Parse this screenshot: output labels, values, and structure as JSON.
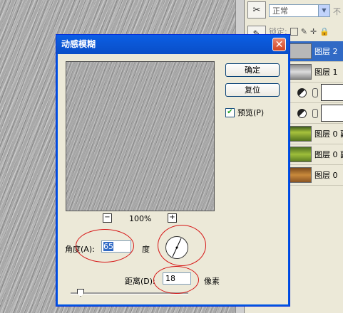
{
  "dialog": {
    "title": "动感模糊",
    "ok_label": "确定",
    "reset_label": "复位",
    "preview_label": "预览(P)",
    "preview_checked": true,
    "zoom_minus": "−",
    "zoom_plus": "+",
    "zoom_value": "100%",
    "angle_label": "角度(A):",
    "angle_value": "65",
    "angle_unit": "度",
    "distance_label": "距离(D):",
    "distance_value": "18",
    "distance_unit": "像素",
    "close_symbol": "✕"
  },
  "layers_panel": {
    "blend_mode": "正常",
    "opacity_cut": "不",
    "lock_label": "锁定:",
    "layers": [
      {
        "name": "图层 2",
        "selected": true,
        "kind": "image"
      },
      {
        "name": "图层 1",
        "selected": false,
        "kind": "image"
      },
      {
        "name": "",
        "selected": false,
        "kind": "adjustment"
      },
      {
        "name": "",
        "selected": false,
        "kind": "adjustment"
      },
      {
        "name": "图层 0 副",
        "selected": false,
        "kind": "image"
      },
      {
        "name": "图层 0 副",
        "selected": false,
        "kind": "image"
      },
      {
        "name": "图层 0",
        "selected": false,
        "kind": "image"
      }
    ]
  },
  "colors": {
    "titlebar": "#0a5ee6",
    "annotation": "#d61414",
    "selection": "#316ac5"
  }
}
